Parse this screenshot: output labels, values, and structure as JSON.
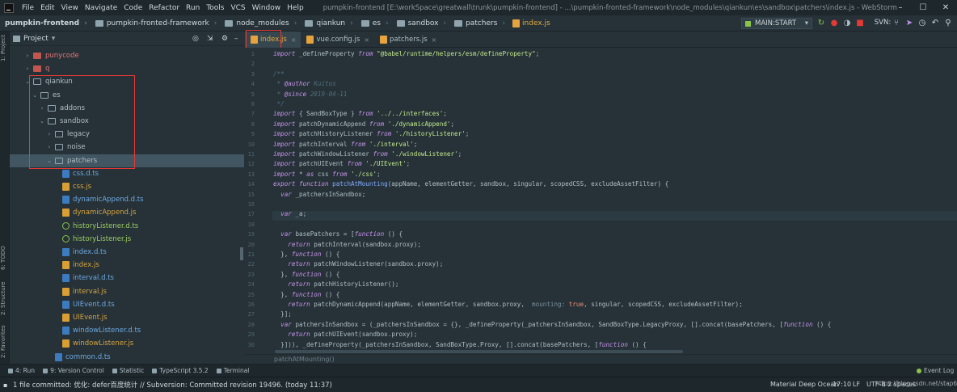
{
  "window": {
    "title": "pumpkin-frontend [E:\\workSpace\\greatwall\\trunk\\pumpkin-frontend] - ...\\pumpkin-fronted-framework\\node_modules\\qiankun\\es\\sandbox\\patchers\\index.js - WebStorm"
  },
  "menu": [
    "File",
    "Edit",
    "View",
    "Navigate",
    "Code",
    "Refactor",
    "Run",
    "Tools",
    "VCS",
    "Window",
    "Help"
  ],
  "breadcrumbs": [
    "pumpkin-frontend",
    "pumpkin-fronted-framework",
    "node_modules",
    "qiankun",
    "es",
    "sandbox",
    "patchers",
    "index.js"
  ],
  "toolbar": {
    "run_config": "MAIN:START",
    "svn_label": "SVN:"
  },
  "left_strip": [
    "1: Project",
    "6: TODO",
    "2: Structure",
    "2: Favorites"
  ],
  "project": {
    "title": "Project",
    "tree": [
      {
        "label": "punycode",
        "type": "folder-red",
        "depth": 2,
        "arrow": "›"
      },
      {
        "label": "q",
        "type": "folder-red",
        "depth": 2,
        "arrow": "›"
      },
      {
        "label": "qiankun",
        "type": "folder",
        "depth": 2,
        "arrow": "⌄"
      },
      {
        "label": "es",
        "type": "folder",
        "depth": 3,
        "arrow": "⌄"
      },
      {
        "label": "addons",
        "type": "folder",
        "depth": 4,
        "arrow": "›"
      },
      {
        "label": "sandbox",
        "type": "folder",
        "depth": 4,
        "arrow": "⌄"
      },
      {
        "label": "legacy",
        "type": "folder",
        "depth": 5,
        "arrow": "›"
      },
      {
        "label": "noise",
        "type": "folder",
        "depth": 5,
        "arrow": "›"
      },
      {
        "label": "patchers",
        "type": "folder",
        "depth": 5,
        "arrow": "⌄",
        "selected": true
      },
      {
        "label": "css.d.ts",
        "type": "ts",
        "depth": 6
      },
      {
        "label": "css.js",
        "type": "js",
        "depth": 6
      },
      {
        "label": "dynamicAppend.d.ts",
        "type": "ts",
        "depth": 6
      },
      {
        "label": "dynamicAppend.js",
        "type": "js",
        "depth": 6
      },
      {
        "label": "historyListener.d.ts",
        "type": "hist",
        "depth": 6
      },
      {
        "label": "historyListener.js",
        "type": "hist",
        "depth": 6
      },
      {
        "label": "index.d.ts",
        "type": "ts",
        "depth": 6
      },
      {
        "label": "index.js",
        "type": "js",
        "depth": 6
      },
      {
        "label": "interval.d.ts",
        "type": "ts",
        "depth": 6
      },
      {
        "label": "interval.js",
        "type": "js",
        "depth": 6
      },
      {
        "label": "UIEvent.d.ts",
        "type": "ts",
        "depth": 6
      },
      {
        "label": "UIEvent.js",
        "type": "js",
        "depth": 6
      },
      {
        "label": "windowListener.d.ts",
        "type": "ts",
        "depth": 6
      },
      {
        "label": "windowListener.js",
        "type": "js",
        "depth": 6
      },
      {
        "label": "common.d.ts",
        "type": "ts",
        "depth": 5
      }
    ]
  },
  "tabs": [
    {
      "label": "index.js",
      "active": true
    },
    {
      "label": "vue.config.js",
      "active": false
    },
    {
      "label": "patchers.js",
      "active": false
    }
  ],
  "code_lines": [
    [
      [
        "kw",
        "import"
      ],
      [
        "p",
        " _defineProperty "
      ],
      [
        "kw",
        "from"
      ],
      [
        "p",
        " "
      ],
      [
        "str",
        "\"@babel/runtime/helpers/esm/defineProperty\""
      ],
      [
        "p",
        ";"
      ]
    ],
    [],
    [
      [
        "cmt",
        "/**"
      ]
    ],
    [
      [
        "cmt",
        " * "
      ],
      [
        "tag",
        "@author"
      ],
      [
        "cmt",
        " Kuitos"
      ]
    ],
    [
      [
        "cmt",
        " * "
      ],
      [
        "tag",
        "@since"
      ],
      [
        "cmt",
        " 2019-04-11"
      ]
    ],
    [
      [
        "cmt",
        " */"
      ]
    ],
    [
      [
        "kw",
        "import"
      ],
      [
        "p",
        " { SandBoxType } "
      ],
      [
        "kw",
        "from"
      ],
      [
        "p",
        " "
      ],
      [
        "str",
        "'../../interfaces'"
      ],
      [
        "p",
        ";"
      ]
    ],
    [
      [
        "kw",
        "import"
      ],
      [
        "p",
        " patchDynamicAppend "
      ],
      [
        "kw",
        "from"
      ],
      [
        "p",
        " "
      ],
      [
        "str",
        "'./dynamicAppend'"
      ],
      [
        "p",
        ";"
      ]
    ],
    [
      [
        "kw",
        "import"
      ],
      [
        "p",
        " patchHistoryListener "
      ],
      [
        "kw",
        "from"
      ],
      [
        "p",
        " "
      ],
      [
        "str",
        "'./historyListener'"
      ],
      [
        "p",
        ";"
      ]
    ],
    [
      [
        "kw",
        "import"
      ],
      [
        "p",
        " patchInterval "
      ],
      [
        "kw",
        "from"
      ],
      [
        "p",
        " "
      ],
      [
        "str",
        "'./interval'"
      ],
      [
        "p",
        ";"
      ]
    ],
    [
      [
        "kw",
        "import"
      ],
      [
        "p",
        " patchWindowListener "
      ],
      [
        "kw",
        "from"
      ],
      [
        "p",
        " "
      ],
      [
        "str",
        "'./windowListener'"
      ],
      [
        "p",
        ";"
      ]
    ],
    [
      [
        "kw",
        "import"
      ],
      [
        "p",
        " patchUIEvent "
      ],
      [
        "kw",
        "from"
      ],
      [
        "p",
        " "
      ],
      [
        "str",
        "'./UIEvent'"
      ],
      [
        "p",
        ";"
      ]
    ],
    [
      [
        "kw",
        "import"
      ],
      [
        "p",
        " * "
      ],
      [
        "kw",
        "as"
      ],
      [
        "p",
        " css "
      ],
      [
        "kw",
        "from"
      ],
      [
        "p",
        " "
      ],
      [
        "str",
        "'./css'"
      ],
      [
        "p",
        ";"
      ]
    ],
    [
      [
        "kw",
        "export function"
      ],
      [
        "p",
        " "
      ],
      [
        "fn",
        "patchAtMounting"
      ],
      [
        "p",
        "(appName, elementGetter, sandbox, singular, scopedCSS, excludeAssetFilter) {"
      ]
    ],
    [
      [
        "p",
        "  "
      ],
      [
        "kw",
        "var"
      ],
      [
        "p",
        " _patchersInSandbox;"
      ]
    ],
    [],
    [
      [
        "p",
        "  "
      ],
      [
        "kw",
        "var"
      ],
      [
        "p",
        " _a;"
      ]
    ],
    [],
    [
      [
        "p",
        "  "
      ],
      [
        "kw",
        "var"
      ],
      [
        "p",
        " basePatchers = ["
      ],
      [
        "kw",
        "function"
      ],
      [
        "p",
        " () {"
      ]
    ],
    [
      [
        "p",
        "    "
      ],
      [
        "kw",
        "return"
      ],
      [
        "p",
        " patchInterval(sandbox.proxy);"
      ]
    ],
    [
      [
        "p",
        "  }, "
      ],
      [
        "kw",
        "function"
      ],
      [
        "p",
        " () {"
      ]
    ],
    [
      [
        "p",
        "    "
      ],
      [
        "kw",
        "return"
      ],
      [
        "p",
        " patchWindowListener(sandbox.proxy);"
      ]
    ],
    [
      [
        "p",
        "  }, "
      ],
      [
        "kw",
        "function"
      ],
      [
        "p",
        " () {"
      ]
    ],
    [
      [
        "p",
        "    "
      ],
      [
        "kw",
        "return"
      ],
      [
        "p",
        " patchHistoryListener();"
      ]
    ],
    [
      [
        "p",
        "  }, "
      ],
      [
        "kw",
        "function"
      ],
      [
        "p",
        " () {"
      ]
    ],
    [
      [
        "p",
        "    "
      ],
      [
        "kw",
        "return"
      ],
      [
        "p",
        " patchDynamicAppend(appName, elementGetter, sandbox.proxy,  "
      ],
      [
        "hint",
        "mounting:"
      ],
      [
        "p",
        " "
      ],
      [
        "lit",
        "true"
      ],
      [
        "p",
        ", singular, scopedCSS, excludeAssetFilter);"
      ]
    ],
    [
      [
        "p",
        "  }];"
      ]
    ],
    [
      [
        "p",
        "  "
      ],
      [
        "kw",
        "var"
      ],
      [
        "p",
        " patchersInSandbox = (_patchersInSandbox = {}, _defineProperty(_patchersInSandbox, SandBoxType.LegacyProxy, [].concat(basePatchers, ["
      ],
      [
        "kw",
        "function"
      ],
      [
        "p",
        " () {"
      ]
    ],
    [
      [
        "p",
        "    "
      ],
      [
        "kw",
        "return"
      ],
      [
        "p",
        " patchUIEvent(sandbox.proxy);"
      ]
    ],
    [
      [
        "p",
        "  }])), _defineProperty(_patchersInSandbox, SandBoxType.Proxy, [].concat(basePatchers, ["
      ],
      [
        "kw",
        "function"
      ],
      [
        "p",
        " () {"
      ]
    ]
  ],
  "line_numbers": [
    "1",
    "2",
    "3",
    "4",
    "5",
    "6",
    "7",
    "8",
    "9",
    "10",
    "11",
    "12",
    "13",
    "14",
    "15",
    "16",
    "17",
    "18",
    "19",
    "20",
    "21",
    "22",
    "23",
    "24",
    "25",
    "26",
    "27",
    "28",
    "29",
    "30"
  ],
  "editor_breadcrumb": "patchAtMounting()",
  "bottom_tools": [
    "4: Run",
    "9: Version Control",
    "Statistic",
    "TypeScript 3.5.2",
    "Terminal"
  ],
  "event_log": "Event Log",
  "status": {
    "message": "1 file committed: 优化: defer百度统计 // Subversion: Committed revision 19496. (today 11:37)",
    "theme": "Material Deep Ocean",
    "position": "17:10",
    "line_sep": "LF",
    "encoding": "UTF-8",
    "indent": "2 spaces"
  },
  "watermark": "https://blog.csdn.net/stap6701",
  "colors": {
    "accent": "#e0a941",
    "highlight_box": "#e53935",
    "background": "#263238"
  }
}
